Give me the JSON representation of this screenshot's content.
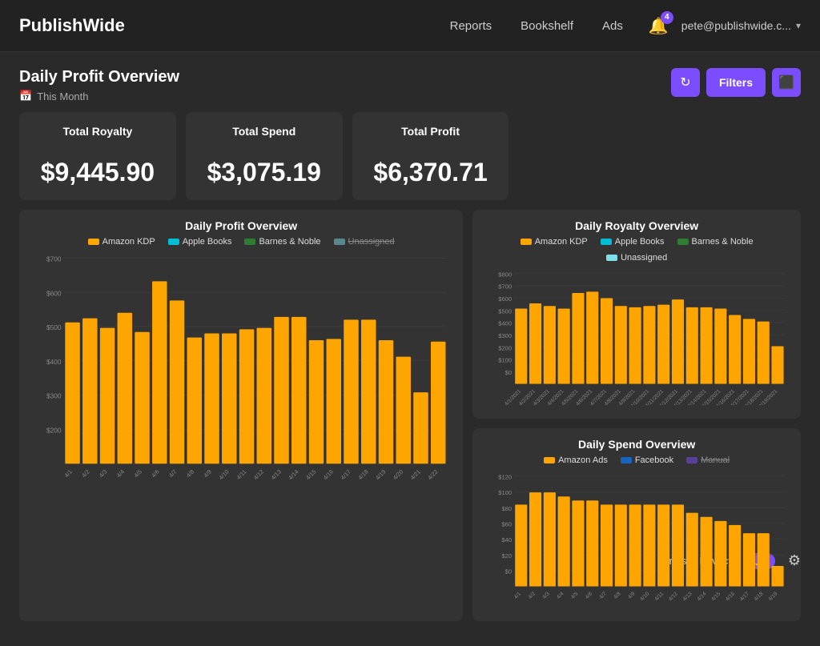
{
  "header": {
    "logo": "PublishWide",
    "nav": [
      {
        "label": "Reports",
        "id": "reports"
      },
      {
        "label": "Bookshelf",
        "id": "bookshelf"
      },
      {
        "label": "Ads",
        "id": "ads"
      }
    ],
    "notification_count": "4",
    "user_email": "pete@publishwide.c...",
    "chevron": "▾"
  },
  "page": {
    "title": "Daily Profit Overview",
    "date_filter": "This Month",
    "toolbar": {
      "refresh_label": "↻",
      "filters_label": "Filters",
      "export_label": "⬜"
    }
  },
  "summary_cards": [
    {
      "label": "Total Royalty",
      "value": "$9,445.90"
    },
    {
      "label": "Total Spend",
      "value": "$3,075.19"
    },
    {
      "label": "Total Profit",
      "value": "$6,370.71"
    }
  ],
  "profit_chart": {
    "title": "Daily Profit Overview",
    "legend": [
      {
        "label": "Amazon KDP",
        "color": "#ffa500"
      },
      {
        "label": "Apple Books",
        "color": "#00bcd4"
      },
      {
        "label": "Barnes & Noble",
        "color": "#2e7d32"
      },
      {
        "label": "Unassigned",
        "color": "#80deea",
        "strikethrough": true
      }
    ],
    "y_labels": [
      "$700",
      "$600",
      "$500",
      "$400",
      "$300",
      "$200"
    ],
    "bars": [
      515,
      530,
      495,
      550,
      480,
      665,
      595,
      460,
      475,
      475,
      490,
      495,
      535,
      535,
      450,
      455,
      525,
      525,
      450,
      390,
      260,
      445
    ],
    "x_labels": [
      "4/1",
      "4/2",
      "4/3",
      "4/4",
      "4/5",
      "4/6",
      "4/7",
      "4/8",
      "4/9",
      "4/10",
      "4/11",
      "4/12",
      "4/13",
      "4/14",
      "4/15",
      "4/16",
      "4/17",
      "4/18",
      "4/19",
      "4/20",
      "4/21",
      "4/22"
    ]
  },
  "royalty_chart": {
    "title": "Daily Royalty Overview",
    "legend": [
      {
        "label": "Amazon KDP",
        "color": "#ffa500"
      },
      {
        "label": "Apple Books",
        "color": "#00bcd4"
      },
      {
        "label": "Barnes & Noble",
        "color": "#2e7d32"
      },
      {
        "label": "Unassigned",
        "color": "#80deea"
      }
    ],
    "y_labels": [
      "$800",
      "$700",
      "$600",
      "$500",
      "$400",
      "$300",
      "$200",
      "$100",
      "$0"
    ],
    "bars": [
      580,
      620,
      600,
      580,
      700,
      710,
      660,
      600,
      590,
      600,
      610,
      650,
      590,
      590,
      580,
      530,
      500,
      480,
      290
    ],
    "x_labels": [
      "4/1/2021",
      "4/2/2021",
      "4/3/2021",
      "4/4/2021",
      "4/5/2021",
      "4/6/2021",
      "4/7/2021",
      "4/8/2021",
      "4/9/2021",
      "4/10/2021",
      "4/11/2021",
      "4/12/2021",
      "4/13/2021",
      "4/14/2021",
      "4/15/2021",
      "4/16/2021",
      "4/17/2021",
      "4/18/2021",
      "4/19/2021"
    ]
  },
  "spend_chart": {
    "title": "Daily Spend Overview",
    "legend": [
      {
        "label": "Amazon Ads",
        "color": "#ffa500"
      },
      {
        "label": "Facebook",
        "color": "#1565c0"
      },
      {
        "label": "Manual",
        "color": "#7c4dff",
        "strikethrough": true
      }
    ],
    "y_labels": [
      "$120",
      "$100",
      "$80",
      "$60",
      "$40",
      "$20",
      "$0"
    ],
    "bars": [
      100,
      115,
      115,
      110,
      105,
      105,
      100,
      100,
      100,
      100,
      100,
      100,
      90,
      85,
      80,
      75,
      65,
      65,
      25
    ],
    "x_labels": [
      "4/1",
      "4/2",
      "4/3",
      "4/4",
      "4/5",
      "4/6",
      "4/7",
      "4/8",
      "4/9",
      "4/10",
      "4/11",
      "4/12",
      "4/13",
      "4/14",
      "4/15",
      "4/16",
      "4/17",
      "4/18",
      "4/19"
    ]
  },
  "footer": {
    "terms": "Terms",
    "privacy": "Privacy"
  }
}
